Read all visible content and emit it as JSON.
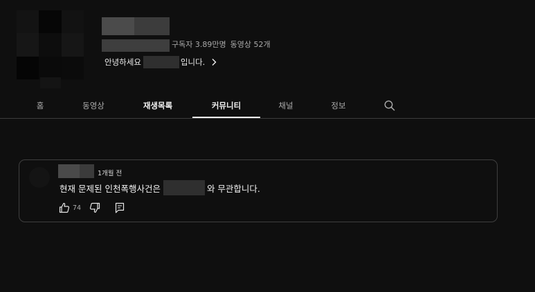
{
  "channel": {
    "stats": {
      "subscribers": "구독자 3.89만명",
      "videos": "동영상 52개"
    },
    "description": {
      "before": "안녕하세요",
      "after": "입니다."
    }
  },
  "tabs": [
    {
      "label": "홈"
    },
    {
      "label": "동영상"
    },
    {
      "label": "재생목록"
    },
    {
      "label": "커뮤니티"
    },
    {
      "label": "채널"
    },
    {
      "label": "정보"
    }
  ],
  "active_tab": "커뮤니티",
  "post": {
    "time": "1개월 전",
    "text_before": "현재 문제된 인천폭행사건은",
    "text_after": "와 무관합니다.",
    "likes": "74"
  },
  "colors": {
    "background": "#0f0f0f",
    "text_primary": "#f1f1f1",
    "text_secondary": "#aaaaaa",
    "divider": "#3d3d3d"
  },
  "icons": {
    "more_description": "chevron-right-icon",
    "search_tab": "search-icon",
    "like": "thumbs-up-icon",
    "dislike": "thumbs-down-icon",
    "comment": "comment-icon"
  }
}
